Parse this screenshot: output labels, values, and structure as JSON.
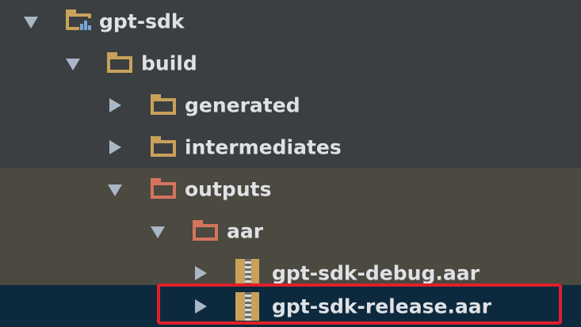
{
  "tree": {
    "items": [
      {
        "label": "gpt-sdk",
        "kind": "module",
        "expanded": true
      },
      {
        "label": "build",
        "kind": "folder",
        "expanded": true
      },
      {
        "label": "generated",
        "kind": "folder",
        "expanded": false
      },
      {
        "label": "intermediates",
        "kind": "folder",
        "expanded": false
      },
      {
        "label": "outputs",
        "kind": "folder-excluded",
        "expanded": true
      },
      {
        "label": "aar",
        "kind": "folder-excluded",
        "expanded": true
      },
      {
        "label": "gpt-sdk-debug.aar",
        "kind": "archive",
        "expanded": false
      },
      {
        "label": "gpt-sdk-release.aar",
        "kind": "archive",
        "expanded": false,
        "selected": true,
        "highlighted": true
      }
    ]
  },
  "colors": {
    "background": "#3c3f41",
    "outputs_row": "#4b4940",
    "selection": "#0d293e",
    "folder": "#c9a15a",
    "excluded_folder": "#d4745f",
    "highlight_box": "#e0202a",
    "text": "#dfe1e5"
  }
}
